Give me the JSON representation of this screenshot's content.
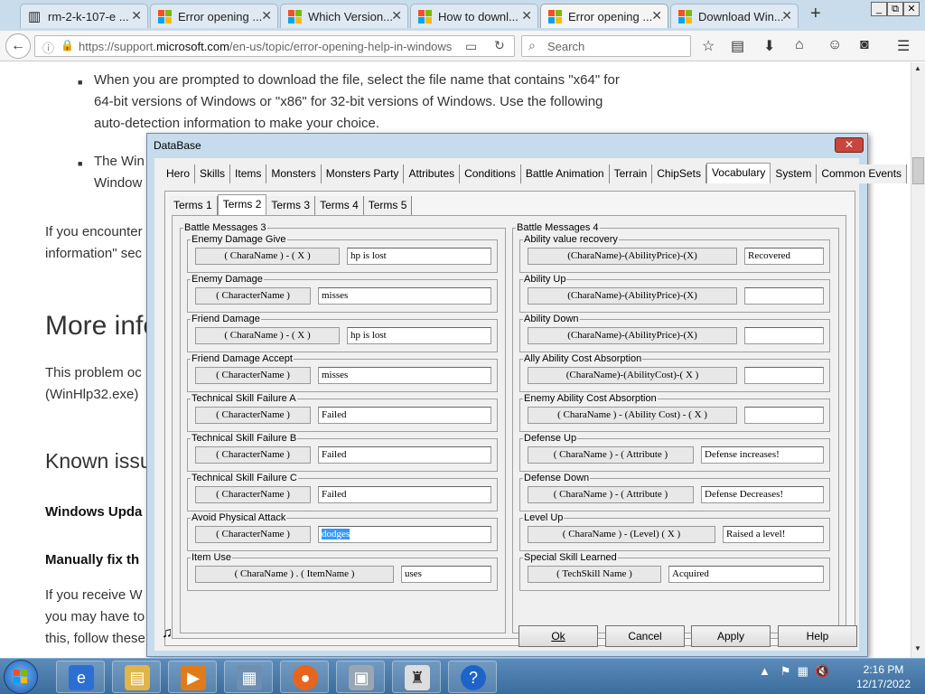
{
  "browser": {
    "tabs": [
      {
        "label": "rm-2-k-107-e ...",
        "icon": "page-icon"
      },
      {
        "label": "Error opening ...",
        "icon": "microsoft-logo-icon"
      },
      {
        "label": "Which Version...",
        "icon": "microsoft-logo-icon"
      },
      {
        "label": "How to downl...",
        "icon": "microsoft-logo-icon"
      },
      {
        "label": "Error opening ...",
        "icon": "microsoft-logo-icon",
        "active": true
      },
      {
        "label": "Download Win...",
        "icon": "microsoft-logo-icon"
      }
    ],
    "new_tab": "+",
    "window_controls": [
      "_",
      "⧉",
      "✕"
    ],
    "url_prefix": "https://support.",
    "url_domain": "microsoft.com",
    "url_suffix": "/en-us/topic/error-opening-help-in-windows",
    "search_placeholder": "Search",
    "brand_colors": {
      "ms_red": "#f25022",
      "ms_green": "#7fba00",
      "ms_blue": "#00a4ef",
      "ms_yellow": "#ffb900"
    }
  },
  "page": {
    "bullet1_line1": "When you are prompted to download the file, select the file name that contains \"x64\" for",
    "bullet1_line2": "64-bit versions of Windows or \"x86\" for 32-bit versions of Windows. Use the following",
    "bullet1_line3": "auto-detection information to make your choice.",
    "bullet2_line1": "The Win",
    "bullet2_line2": "Window",
    "para1_line1": "If you encounter",
    "para1_line2": "information\" sec",
    "heading1": "More info",
    "para2_line1": "This problem oc",
    "para2_line2": "(WinHlp32.exe)",
    "heading2": "Known issu",
    "bold1": "Windows Upda",
    "bold2": "Manually fix th",
    "para3_line1": "If you receive W",
    "para3_line2": "you may have to",
    "para3_line3": "this, follow these"
  },
  "dialog": {
    "title": "DataBase",
    "close": "✕",
    "main_tabs": [
      "Hero",
      "Skills",
      "Items",
      "Monsters",
      "Monsters Party",
      "Attributes",
      "Conditions",
      "Battle Animation",
      "Terrain",
      "ChipSets",
      "Vocabulary",
      "System",
      "Common Events"
    ],
    "active_main_tab": "Vocabulary",
    "sub_tabs": [
      "Terms 1",
      "Terms 2",
      "Terms 3",
      "Terms 4",
      "Terms 5"
    ],
    "active_sub_tab": "Terms 2",
    "left_group": "Battle Messages 3",
    "right_group": "Battle Messages 4",
    "left_rows": [
      {
        "label": "Enemy Damage Give",
        "param": "( CharaName ) - ( X )",
        "value": "hp is lost"
      },
      {
        "label": "Enemy Damage",
        "param": "( CharacterName )",
        "value": "misses"
      },
      {
        "label": "Friend Damage",
        "param": "( CharaName ) - ( X )",
        "value": "hp is lost"
      },
      {
        "label": "Friend Damage Accept",
        "param": "( CharacterName )",
        "value": "misses"
      },
      {
        "label": "Technical Skill Failure A",
        "param": "( CharacterName )",
        "value": "Failed"
      },
      {
        "label": "Technical Skill Failure B",
        "param": "( CharacterName )",
        "value": "Failed"
      },
      {
        "label": "Technical Skill Failure C",
        "param": "( CharacterName )",
        "value": "Failed"
      },
      {
        "label": "Avoid Physical Attack",
        "param": "( CharacterName )",
        "value": "dodges"
      },
      {
        "label": "Item Use",
        "param": "( CharaName ) . ( ItemName )",
        "value": "uses"
      }
    ],
    "right_rows": [
      {
        "label": "Ability value recovery",
        "param": "(CharaName)-(AbilityPrice)-(X)",
        "value": "Recovered"
      },
      {
        "label": "Ability Up",
        "param": "(CharaName)-(AbilityPrice)-(X)",
        "value": ""
      },
      {
        "label": "Ability Down",
        "param": "(CharaName)-(AbilityPrice)-(X)",
        "value": ""
      },
      {
        "label": "Ally Ability Cost Absorption",
        "param": "(CharaName)-(AbilityCost)-( X )",
        "value": ""
      },
      {
        "label": "Enemy Ability Cost Absorption",
        "param": "( CharaName ) - (Ability Cost) - ( X )",
        "value": ""
      },
      {
        "label": "Defense Up",
        "param": "( CharaName ) - ( Attribute )",
        "value": "Defense increases!"
      },
      {
        "label": "Defense Down",
        "param": "( CharaName ) - ( Attribute )",
        "value": "Defense Decreases!"
      },
      {
        "label": "Level Up",
        "param": "( CharaName ) - (Level) ( X )",
        "value": "Raised a level!"
      },
      {
        "label": "Special Skill Learned",
        "param": "( TechSkill Name )",
        "value": "Acquired"
      }
    ],
    "buttons": {
      "ok": "Ok",
      "cancel": "Cancel",
      "apply": "Apply",
      "help": "Help"
    },
    "music_icon": "♫"
  },
  "taskbar": {
    "items": [
      "internet-explorer-icon",
      "file-explorer-icon",
      "media-player-icon",
      "control-panel-icon",
      "firefox-icon",
      "documents-icon",
      "castle-game-icon",
      "help-icon"
    ],
    "time": "2:16 PM",
    "date": "12/17/2022"
  }
}
